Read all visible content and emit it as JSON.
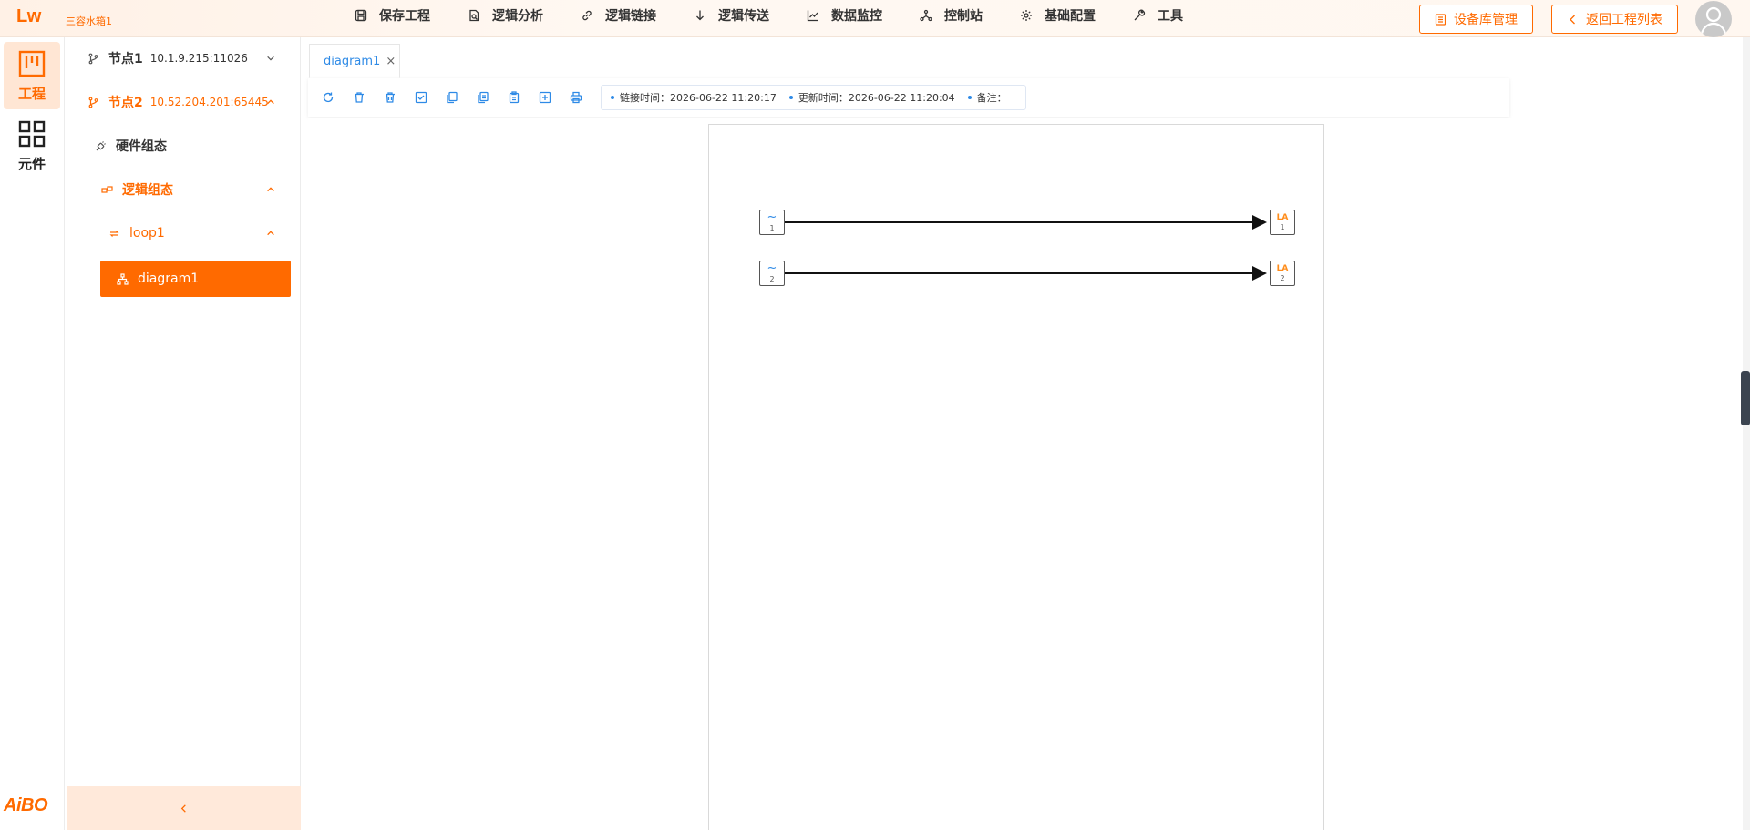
{
  "app": {
    "logo": "Lw",
    "project_name": "三容水箱1",
    "brand_bottom": "AiBO"
  },
  "menu": [
    {
      "label": "保存工程",
      "icon": "save-icon"
    },
    {
      "label": "逻辑分析",
      "icon": "analysis-icon"
    },
    {
      "label": "逻辑链接",
      "icon": "link-icon"
    },
    {
      "label": "逻辑传送",
      "icon": "arrow-down-icon"
    },
    {
      "label": "数据监控",
      "icon": "chart-line-icon"
    },
    {
      "label": "控制站",
      "icon": "network-icon"
    },
    {
      "label": "基础配置",
      "icon": "gear-icon"
    },
    {
      "label": "工具",
      "icon": "wrench-icon"
    }
  ],
  "header_buttons": {
    "device_library": "设备库管理",
    "back_to_list": "返回工程列表"
  },
  "rail": [
    {
      "label": "工程",
      "icon": "project-icon",
      "active": true
    },
    {
      "label": "元件",
      "icon": "grid-icon",
      "active": false
    }
  ],
  "tree": {
    "node1": {
      "label": "节点1",
      "address": "10.1.9.215:11026"
    },
    "node2": {
      "label": "节点2",
      "address": "10.52.204.201:65445"
    },
    "hardware": "硬件组态",
    "logic": "逻辑组态",
    "loop": "loop1",
    "diagram": "diagram1"
  },
  "tabs": [
    {
      "label": "diagram1",
      "close": "×"
    }
  ],
  "toolbar": {
    "tools": [
      "refresh-icon",
      "delete-icon",
      "delete-all-icon",
      "check-icon",
      "copy-icon",
      "copy-multi-icon",
      "paste-icon",
      "add-icon",
      "print-icon"
    ],
    "link_time_label": "链接时间：",
    "link_time": "2026-06-22 11:20:17",
    "update_time_label": "更新时间：",
    "update_time": "2026-06-22 11:20:04",
    "remark_label": "备注："
  },
  "diagram": {
    "blocks": [
      {
        "kind": "signal",
        "symbol": "~",
        "number": "1"
      },
      {
        "kind": "signal",
        "symbol": "~",
        "number": "2"
      },
      {
        "kind": "LA",
        "symbol": "LA",
        "number": "1"
      },
      {
        "kind": "LA",
        "symbol": "LA",
        "number": "2"
      }
    ]
  },
  "colors": {
    "accent": "#ff6a00",
    "link_blue": "#2e8ae6",
    "selected_bg": "#ff6a00",
    "rail_active_bg": "#ffe6d4"
  }
}
